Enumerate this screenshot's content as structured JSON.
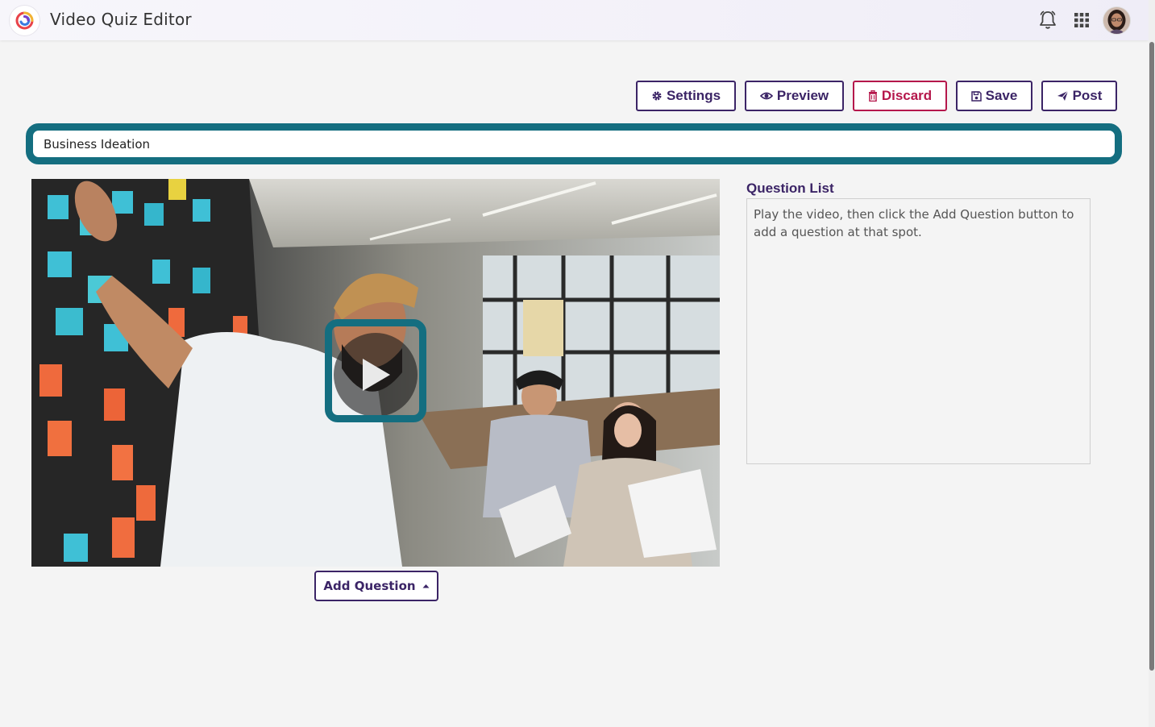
{
  "header": {
    "title": "Video Quiz Editor",
    "icons": [
      "logo-icon",
      "bell-icon",
      "apps-grid-icon",
      "avatar"
    ]
  },
  "toolbar": {
    "settings_label": "Settings",
    "preview_label": "Preview",
    "discard_label": "Discard",
    "save_label": "Save",
    "post_label": "Post",
    "accent": "#3b2466",
    "danger": "#b5174b"
  },
  "quiz": {
    "title_value": "Business Ideation",
    "focus_color": "#146e80"
  },
  "video": {
    "add_question_label": "Add Question"
  },
  "question_list": {
    "heading": "Question List",
    "empty_message": "Play the video, then click the Add Question button to add a question at that spot."
  }
}
